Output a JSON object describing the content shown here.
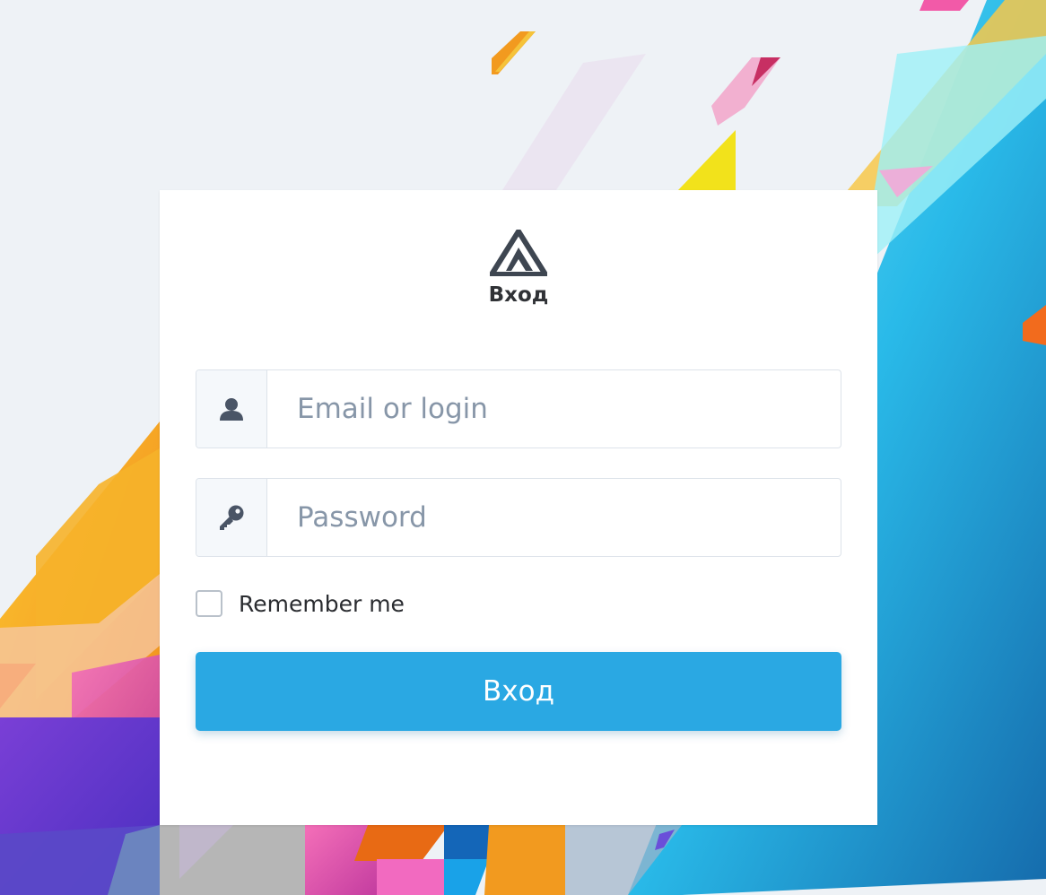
{
  "login": {
    "title": "Вход",
    "email_placeholder": "Email or login",
    "password_placeholder": "Password",
    "remember_label": "Remember me",
    "remember_checked": false,
    "submit_label": "Вход"
  },
  "icons": {
    "logo": "logo-triangle-icon",
    "email_field": "user-icon",
    "password_field": "key-icon"
  },
  "colors": {
    "background": "#eef2f6",
    "primary_button": "#2aa8e3",
    "icon": "#4a5566"
  }
}
